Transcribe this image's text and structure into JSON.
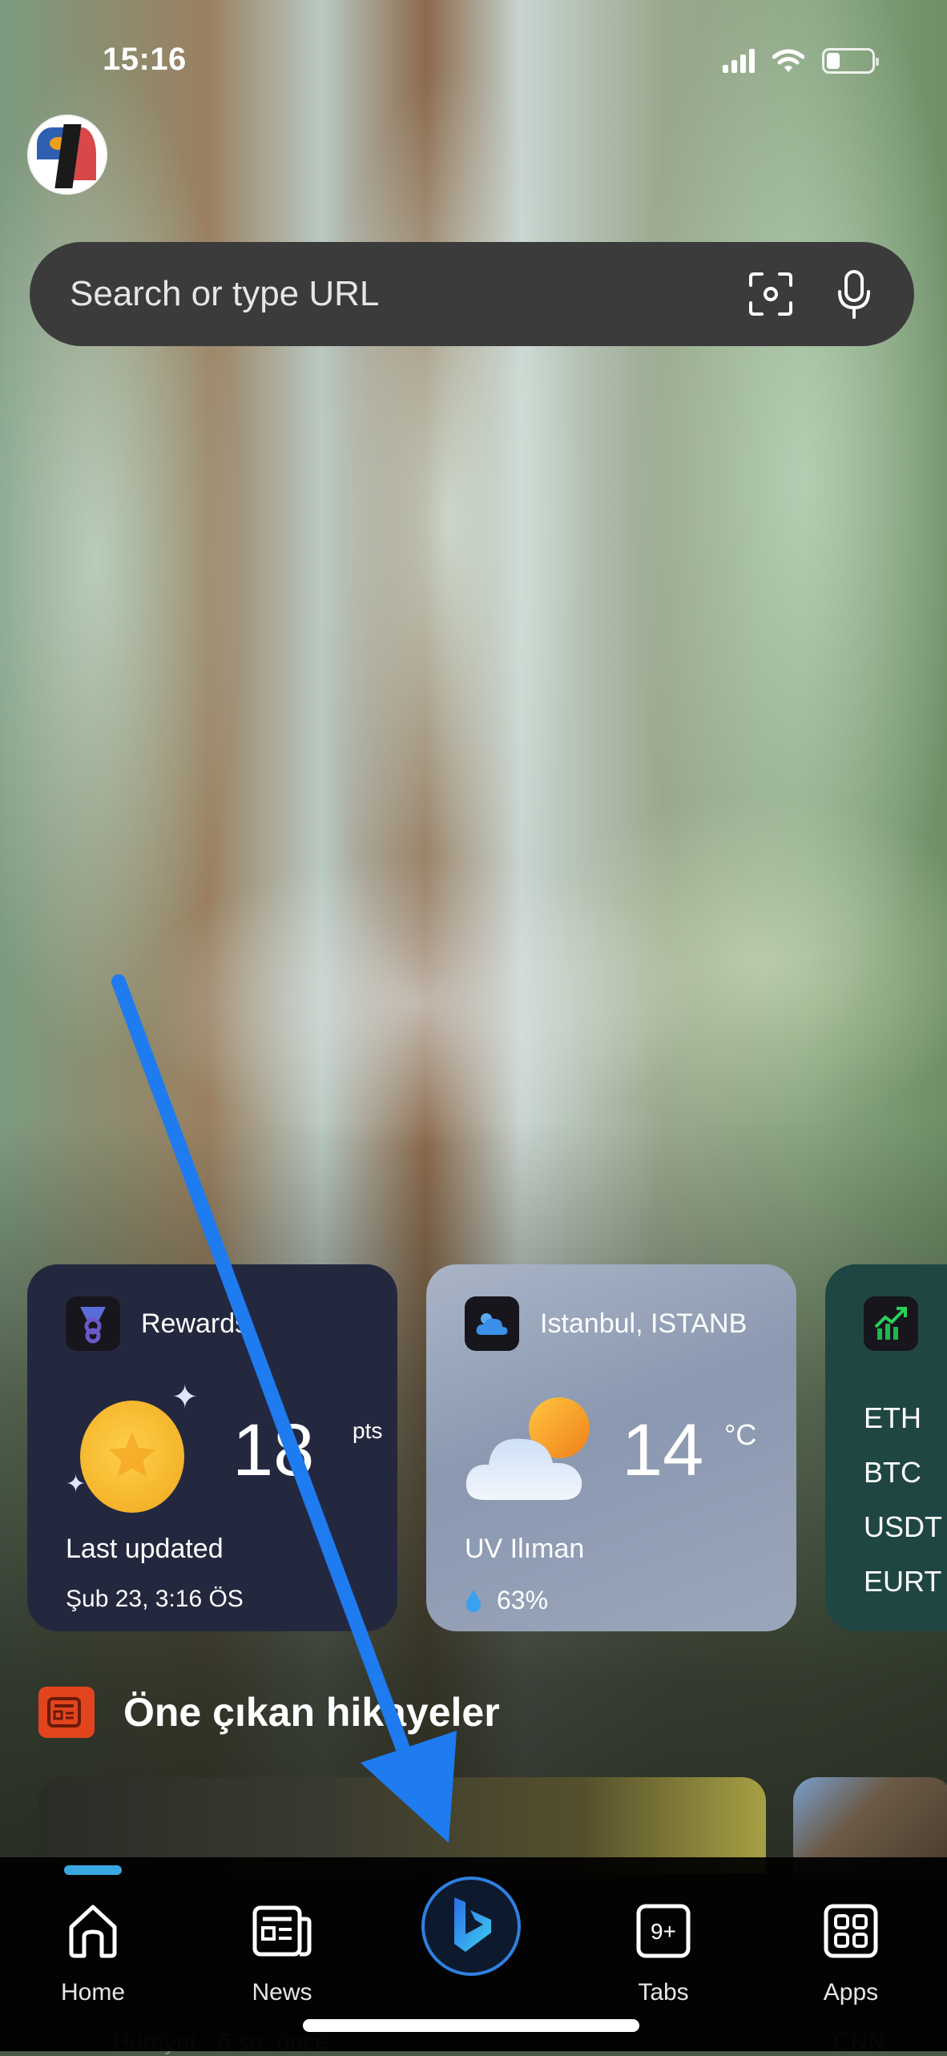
{
  "status_bar": {
    "time": "15:16",
    "signal_bars": 4,
    "wifi": true,
    "battery_level": 0.3
  },
  "profile": {
    "avatar_icon": "avatar"
  },
  "search": {
    "placeholder": "Search or type URL",
    "visual_search_icon": "camera-scan-icon",
    "voice_icon": "microphone-icon"
  },
  "widgets": {
    "rewards": {
      "title": "Rewards",
      "points": "18",
      "points_unit": "pts",
      "last_updated_label": "Last updated",
      "last_updated_value": "Şub 23, 3:16 ÖS"
    },
    "weather": {
      "location": "Istanbul, ISTANB",
      "temperature": "14",
      "unit": "°C",
      "uv": "UV Ilıman",
      "humidity": "63%"
    },
    "market": {
      "tickers": [
        "ETH",
        "BTC",
        "USDT",
        "EURT"
      ]
    }
  },
  "section": {
    "title": "Öne çıkan hikayeler"
  },
  "stories": [
    {
      "source": "Hürriyet · 6 sa. önce"
    },
    {
      "source": "CNN"
    }
  ],
  "bottom_nav": {
    "items": [
      {
        "label": "Home",
        "icon": "home-icon",
        "active": true
      },
      {
        "label": "News",
        "icon": "news-icon",
        "active": false
      },
      {
        "label": "",
        "icon": "copilot-icon",
        "active": false
      },
      {
        "label": "Tabs",
        "icon": "tabs-icon",
        "badge": "9+",
        "active": false
      },
      {
        "label": "Apps",
        "icon": "apps-icon",
        "active": false
      }
    ]
  },
  "colors": {
    "accent": "#3aa8e0",
    "copilot_ring": "#2f7fe0",
    "annotation_arrow": "#1e7bf0",
    "news_badge": "#e2451e",
    "rewards_bg": "#24283f",
    "market_bg": "#1f4643"
  }
}
